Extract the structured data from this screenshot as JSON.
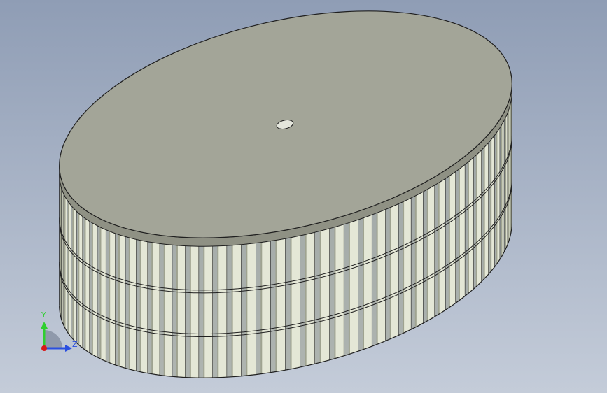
{
  "viewport": {
    "background_top": "#8f9db5",
    "background_bottom": "#c4ccd9"
  },
  "model": {
    "type": "centrifugal-fan-impeller",
    "body_color": "#a3a598",
    "edge_color": "#1f1f1f",
    "blade_light": "#e4e7d6",
    "blade_dark": "#9fa390",
    "ring_count": 3,
    "blade_count": 48
  },
  "triad": {
    "y_label": "Y",
    "z_label": "Z",
    "y_color": "#2fcf2f",
    "z_color": "#2a4fe0",
    "origin_color": "#d81818"
  }
}
